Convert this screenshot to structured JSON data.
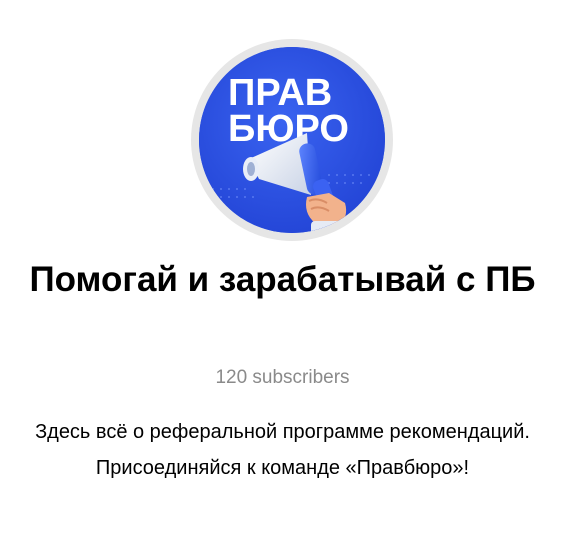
{
  "avatar": {
    "logo_line1": "ПРАВ",
    "logo_line2": "БЮРО",
    "background_color": "#2d55e6",
    "icon": "megaphone-icon"
  },
  "channel": {
    "title": "Помогай и зарабатывай с ПБ",
    "subscribers": "120 subscribers",
    "description": "Здесь всё о реферальной программе рекомендаций. Присоединяйся к команде «Правбюро»!"
  },
  "colors": {
    "accent": "#2d55e6",
    "muted_text": "#8a8a8a",
    "text": "#000000"
  }
}
